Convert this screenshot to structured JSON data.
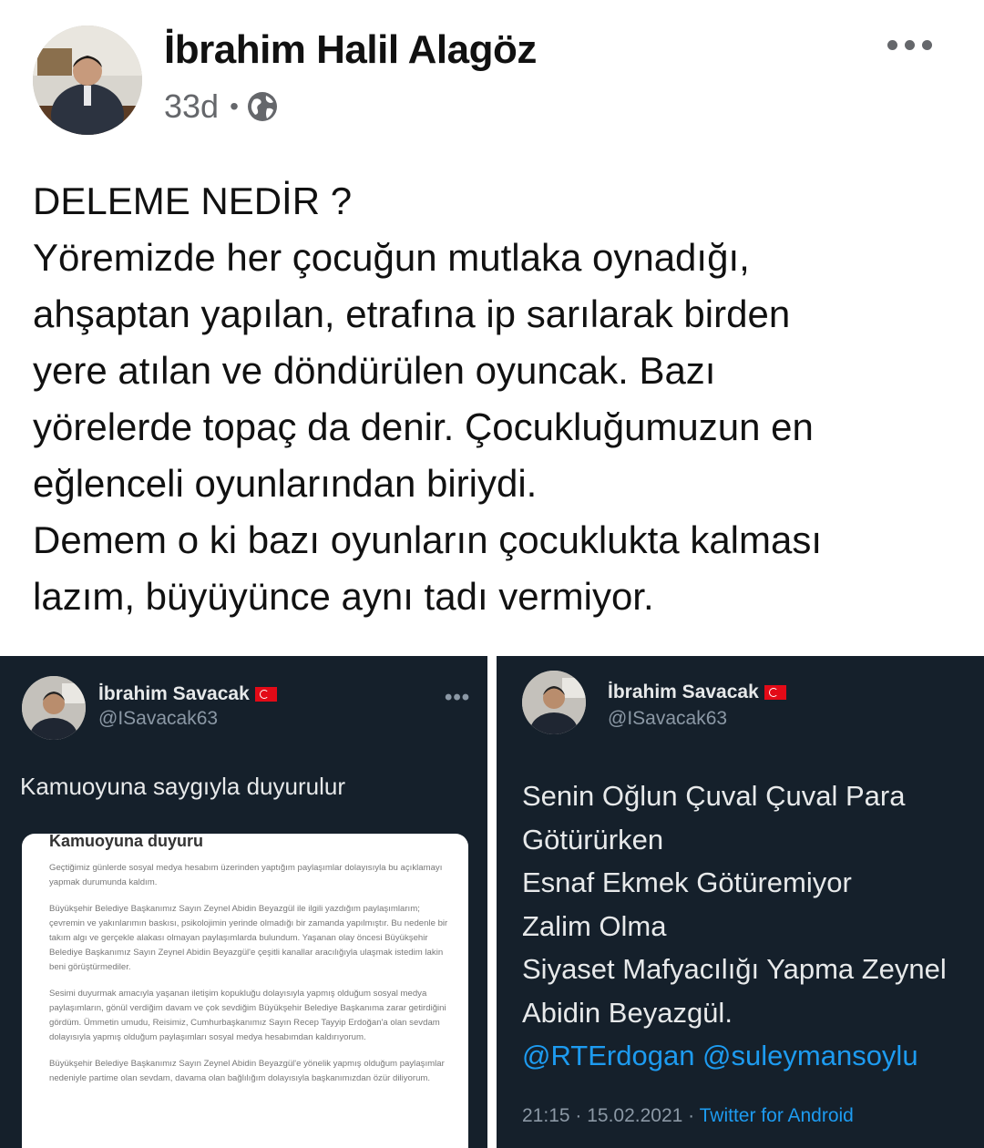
{
  "post": {
    "author": "İbrahim Halil Alagöz",
    "time": "33d",
    "separator": "•",
    "lines": [
      "DELEME NEDİR ?",
      "Yöremizde her çocuğun mutlaka oynadığı,",
      "ahşaptan yapılan, etrafına ip sarılarak birden",
      "yere atılan ve döndürülen oyuncak. Bazı",
      "yörelerde topaç da denir. Çocukluğumuzun en",
      "eğlenceli oyunlarından biriydi.",
      "Demem o ki bazı oyunların çocuklukta kalması",
      "lazım, büyüyünce aynı tadı vermiyor."
    ]
  },
  "tweet_left": {
    "name": "İbrahim Savacak",
    "handle": "@ISavacak63",
    "more": "•••",
    "text": "Kamuoyuna saygıyla duyurulur",
    "card": {
      "title": "Kamuoyuna duyuru",
      "paragraphs": [
        "Geçtiğimiz günlerde sosyal medya hesabım üzerinden yaptığım paylaşımlar dolayısıyla bu açıklamayı yapmak durumunda kaldım.",
        "Büyükşehir Belediye Başkanımız Sayın Zeynel Abidin Beyazgül ile ilgili yazdığım paylaşımlarım; çevremin ve yakınlarımın baskısı, psikolojimin yerinde olmadığı bir zamanda yapılmıştır. Bu nedenle bir takım algı ve gerçekle alakası olmayan paylaşımlarda bulundum. Yaşanan olay öncesi Büyükşehir Belediye Başkanımız Sayın Zeynel Abidin Beyazgül'e çeşitli kanallar aracılığıyla ulaşmak istedim lakin beni görüştürmediler.",
        "Sesimi duyurmak amacıyla yaşanan iletişim kopukluğu dolayısıyla yapmış olduğum sosyal medya paylaşımların, gönül verdiğim davam ve çok sevdiğim Büyükşehir Belediye Başkanıma zarar getirdiğini gördüm. Ümmetin umudu, Reisimiz, Cumhurbaşkanımız Sayın Recep Tayyip Erdoğan'a olan sevdam dolayısıyla yapmış olduğum paylaşımları sosyal medya hesabımdan kaldırıyorum.",
        "Büyükşehir Belediye Başkanımız Sayın Zeynel Abidin Beyazgül'e yönelik yapmış olduğum paylaşımlar nedeniyle partime olan sevdam, davama olan bağlılığım dolayısıyla başkanımızdan özür diliyorum."
      ]
    }
  },
  "tweet_right": {
    "name": "İbrahim Savacak",
    "handle": "@ISavacak63",
    "lines": [
      "Senin Oğlun Çuval Çuval Para",
      "Götürürken",
      "Esnaf Ekmek Götüremiyor",
      "Zalim Olma",
      "Siyaset Mafyacılığı Yapma Zeynel",
      "Abidin Beyazgül."
    ],
    "mentions": "@RTErdogan @suleymansoylu",
    "timestamp": "21:15 · 15.02.2021 ·",
    "source": "Twitter for Android"
  },
  "colors": {
    "twitter_dark_bg": "#15202b",
    "twitter_blue": "#1d9bf0",
    "muted_gray": "#65676b",
    "flag_red": "#e30a17"
  },
  "icons": [
    "globe-icon",
    "more-horizontal-icon",
    "turkey-flag-icon"
  ]
}
